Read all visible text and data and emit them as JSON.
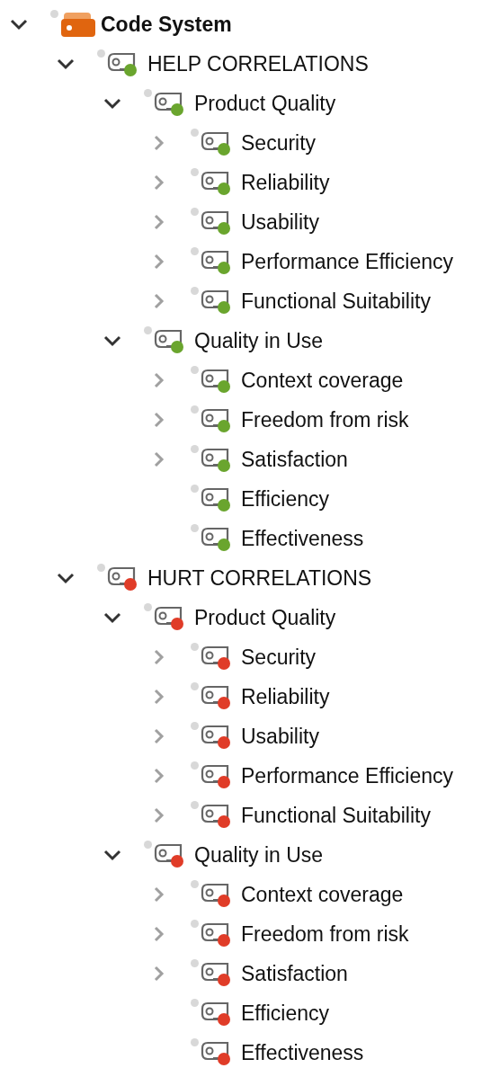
{
  "tree": [
    {
      "label": "Code System",
      "kind": "root",
      "expanded": true,
      "children": [
        {
          "label": "HELP CORRELATIONS",
          "kind": "group",
          "color": "#6aa52e",
          "expanded": true,
          "children": [
            {
              "label": "Product Quality",
              "kind": "group",
              "color": "#6aa52e",
              "expanded": true,
              "children": [
                {
                  "label": "Security",
                  "kind": "group",
                  "color": "#6aa52e",
                  "expanded": false
                },
                {
                  "label": "Reliability",
                  "kind": "group",
                  "color": "#6aa52e",
                  "expanded": false
                },
                {
                  "label": "Usability",
                  "kind": "group",
                  "color": "#6aa52e",
                  "expanded": false
                },
                {
                  "label": "Performance Efficiency",
                  "kind": "group",
                  "color": "#6aa52e",
                  "expanded": false
                },
                {
                  "label": "Functional Suitability",
                  "kind": "group",
                  "color": "#6aa52e",
                  "expanded": false
                }
              ]
            },
            {
              "label": "Quality in Use",
              "kind": "group",
              "color": "#6aa52e",
              "expanded": true,
              "children": [
                {
                  "label": "Context coverage",
                  "kind": "group",
                  "color": "#6aa52e",
                  "expanded": false
                },
                {
                  "label": "Freedom from risk",
                  "kind": "group",
                  "color": "#6aa52e",
                  "expanded": false
                },
                {
                  "label": "Satisfaction",
                  "kind": "group",
                  "color": "#6aa52e",
                  "expanded": false
                },
                {
                  "label": "Efficiency",
                  "kind": "leaf",
                  "color": "#6aa52e"
                },
                {
                  "label": "Effectiveness",
                  "kind": "leaf",
                  "color": "#6aa52e"
                }
              ]
            }
          ]
        },
        {
          "label": "HURT CORRELATIONS",
          "kind": "group",
          "color": "#e03c28",
          "expanded": true,
          "children": [
            {
              "label": "Product Quality",
              "kind": "group",
              "color": "#e03c28",
              "expanded": true,
              "children": [
                {
                  "label": "Security",
                  "kind": "group",
                  "color": "#e03c28",
                  "expanded": false
                },
                {
                  "label": "Reliability",
                  "kind": "group",
                  "color": "#e03c28",
                  "expanded": false
                },
                {
                  "label": "Usability",
                  "kind": "group",
                  "color": "#e03c28",
                  "expanded": false
                },
                {
                  "label": "Performance Efficiency",
                  "kind": "group",
                  "color": "#e03c28",
                  "expanded": false
                },
                {
                  "label": "Functional Suitability",
                  "kind": "group",
                  "color": "#e03c28",
                  "expanded": false
                }
              ]
            },
            {
              "label": "Quality in Use",
              "kind": "group",
              "color": "#e03c28",
              "expanded": true,
              "children": [
                {
                  "label": "Context coverage",
                  "kind": "group",
                  "color": "#e03c28",
                  "expanded": false
                },
                {
                  "label": "Freedom from risk",
                  "kind": "group",
                  "color": "#e03c28",
                  "expanded": false
                },
                {
                  "label": "Satisfaction",
                  "kind": "group",
                  "color": "#e03c28",
                  "expanded": false
                },
                {
                  "label": "Efficiency",
                  "kind": "leaf",
                  "color": "#e03c28"
                },
                {
                  "label": "Effectiveness",
                  "kind": "leaf",
                  "color": "#e03c28"
                }
              ]
            }
          ]
        }
      ]
    }
  ]
}
